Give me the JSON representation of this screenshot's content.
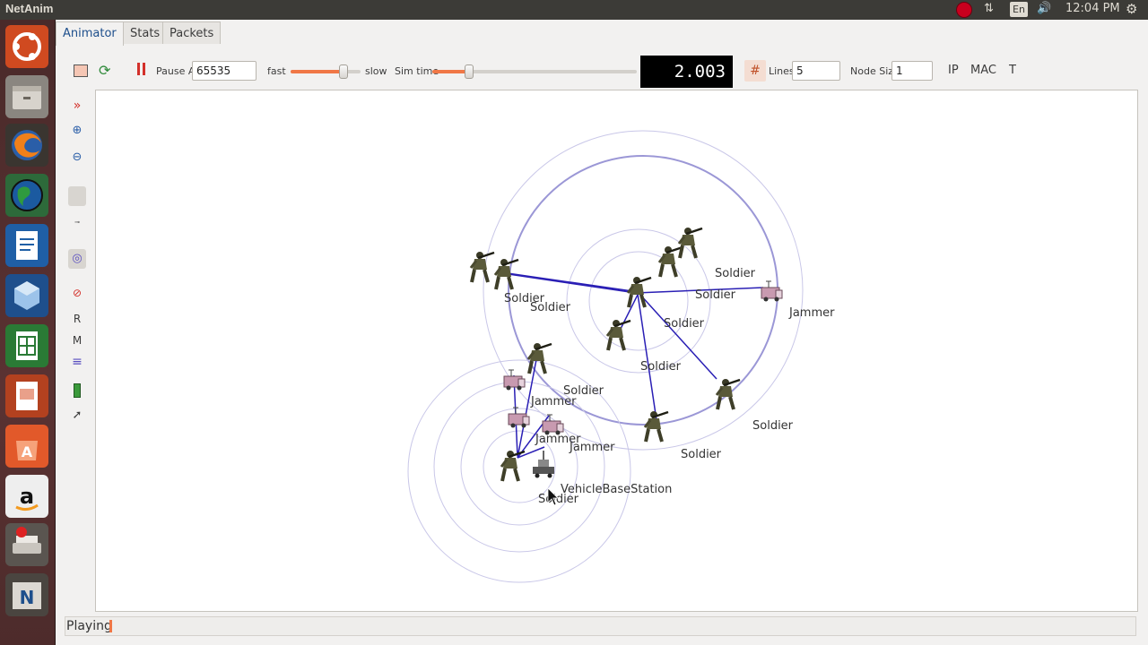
{
  "system": {
    "app_title": "NetAnim",
    "lang": "En",
    "clock": "12:04 PM",
    "icons": [
      "record-icon",
      "network-icon",
      "keyboard-icon",
      "volume-icon",
      "settings-icon"
    ]
  },
  "launcher": {
    "items": [
      "ubuntu-dash-icon",
      "files-icon",
      "firefox-icon",
      "earth-icon",
      "writer-icon",
      "virtualbox-icon",
      "calc-icon",
      "impress-icon",
      "software-center-icon",
      "amazon-icon",
      "scanner-icon",
      "netanim-icon"
    ]
  },
  "tabs": [
    {
      "label": "Animator",
      "active": true
    },
    {
      "label": "Stats",
      "active": false
    },
    {
      "label": "Packets",
      "active": false
    }
  ],
  "toolbar": {
    "pause_at_label": "Pause At",
    "pause_at_value": "65535",
    "fast_label": "fast",
    "slow_label": "slow",
    "speed_level": 0.75,
    "sim_time_label": "Sim time",
    "sim_time_level": 0.18,
    "sim_time_display": "2.003",
    "lines_label": "Lines",
    "lines_value": "5",
    "node_size_label": "Node Size",
    "node_size_value": "1",
    "ip_label": "IP",
    "mac_label": "MAC",
    "t_label": "T"
  },
  "side_tools": {
    "r_label": "R",
    "m_label": "M"
  },
  "status": {
    "text": "Playing"
  },
  "nodes": {
    "labels": {
      "soldier": "Soldier",
      "jammer": "Jammer",
      "vbs": "VehicleBaseStation"
    }
  },
  "colors": {
    "link": "#2a1fb5",
    "range_ring": "#9b97d6",
    "accent": "#f07746",
    "launcher_bg": "#4a2a2a"
  }
}
